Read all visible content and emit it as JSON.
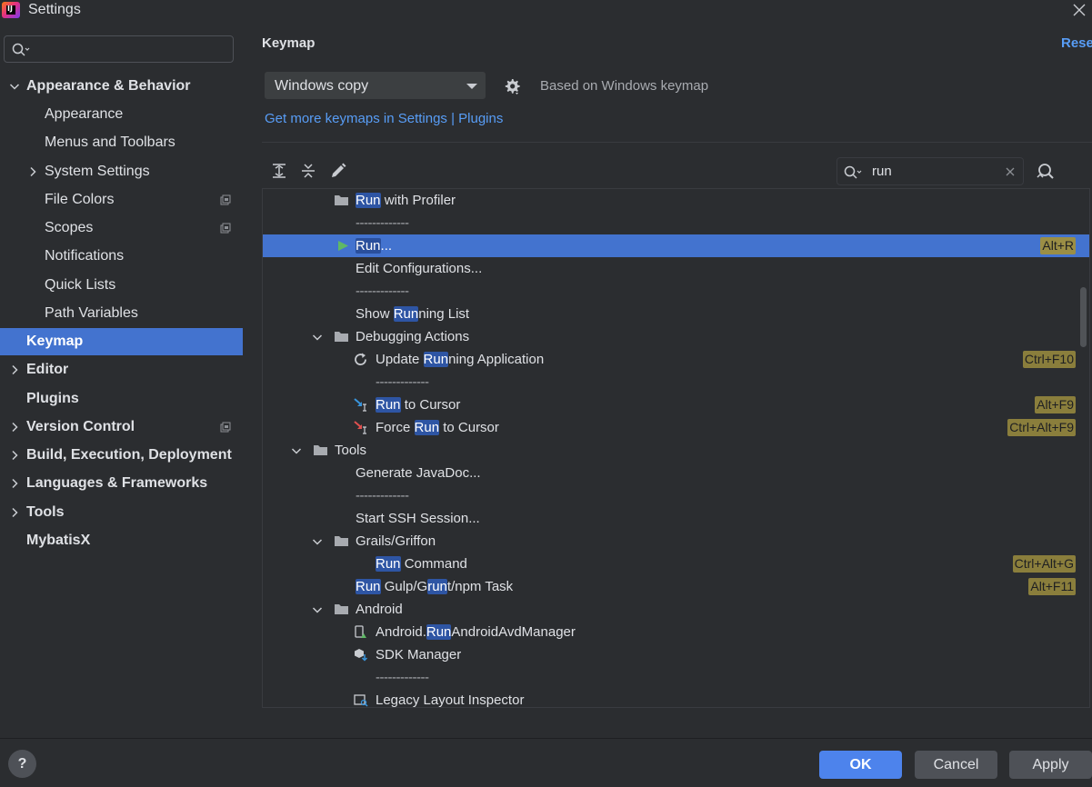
{
  "window": {
    "title": "Settings",
    "app_icon_text": "IJ"
  },
  "sidebar": {
    "search_placeholder": "",
    "items": [
      {
        "label": "Appearance & Behavior"
      },
      {
        "label": "Appearance"
      },
      {
        "label": "Menus and Toolbars"
      },
      {
        "label": "System Settings"
      },
      {
        "label": "File Colors"
      },
      {
        "label": "Scopes"
      },
      {
        "label": "Notifications"
      },
      {
        "label": "Quick Lists"
      },
      {
        "label": "Path Variables"
      },
      {
        "label": "Keymap"
      },
      {
        "label": "Editor"
      },
      {
        "label": "Plugins"
      },
      {
        "label": "Version Control"
      },
      {
        "label": "Build, Execution, Deployment"
      },
      {
        "label": "Languages & Frameworks"
      },
      {
        "label": "Tools"
      },
      {
        "label": "MybatisX"
      }
    ],
    "selected": "Keymap"
  },
  "main": {
    "title": "Keymap",
    "reset_label": "Reset",
    "keymap_selected": "Windows copy",
    "based_on": "Based on Windows keymap",
    "get_more_link": "Get more keymaps in Settings | Plugins",
    "filter_value": "run"
  },
  "tree": {
    "rows": [
      {
        "pre": "",
        "hl": "Run",
        "post": " with Profiler",
        "shortcut": ""
      },
      {
        "text": "-------------"
      },
      {
        "pre": "",
        "hl": "Run",
        "post": "...",
        "shortcut": "Alt+R"
      },
      {
        "text": "Edit Configurations..."
      },
      {
        "text": "-------------"
      },
      {
        "pre": "Show ",
        "hl": "Run",
        "post": "ning List",
        "shortcut": ""
      },
      {
        "text": "Debugging Actions"
      },
      {
        "pre": "Update ",
        "hl": "Run",
        "post": "ning Application",
        "shortcut": "Ctrl+F10"
      },
      {
        "text": "-------------"
      },
      {
        "pre": "",
        "hl": "Run",
        "post": " to Cursor",
        "shortcut": "Alt+F9"
      },
      {
        "pre": "Force ",
        "hl": "Run",
        "post": " to Cursor",
        "shortcut": "Ctrl+Alt+F9"
      },
      {
        "text": "Tools"
      },
      {
        "text": "Generate JavaDoc..."
      },
      {
        "text": "-------------"
      },
      {
        "text": "Start SSH Session..."
      },
      {
        "text": "Grails/Griffon"
      },
      {
        "pre": "",
        "hl": "Run",
        "post": " Command",
        "shortcut": "Ctrl+Alt+G"
      },
      {
        "pre": "",
        "hl": "Run",
        "post": " Gulp/G",
        "hl2": "run",
        "post2": "t/npm Task",
        "shortcut": "Alt+F11"
      },
      {
        "text": "Android"
      },
      {
        "pre": "Android.",
        "hl": "Run",
        "post": "AndroidAvdManager",
        "shortcut": ""
      },
      {
        "text": "SDK Manager"
      },
      {
        "text": "-------------"
      },
      {
        "text": "Legacy Layout Inspector"
      }
    ]
  },
  "footer": {
    "help": "?",
    "ok": "OK",
    "cancel": "Cancel",
    "apply": "Apply"
  },
  "colors": {
    "background": "#2b2d30",
    "selection": "#4373cf",
    "link": "#589df6",
    "highlight": "#2e55a4",
    "shortcut_badge": "#8a7e3c"
  },
  "icons": [
    "search-icon",
    "chevron-down-icon",
    "chevron-right-icon",
    "gear-icon",
    "expand-all-icon",
    "collapse-all-icon",
    "edit-icon",
    "close-icon",
    "find-shortcut-icon",
    "folder-icon",
    "run-icon",
    "refresh-icon",
    "run-to-cursor-icon",
    "force-run-to-cursor-icon",
    "android-device-icon",
    "sdk-manager-icon",
    "layout-inspector-icon",
    "project-scope-icon"
  ]
}
